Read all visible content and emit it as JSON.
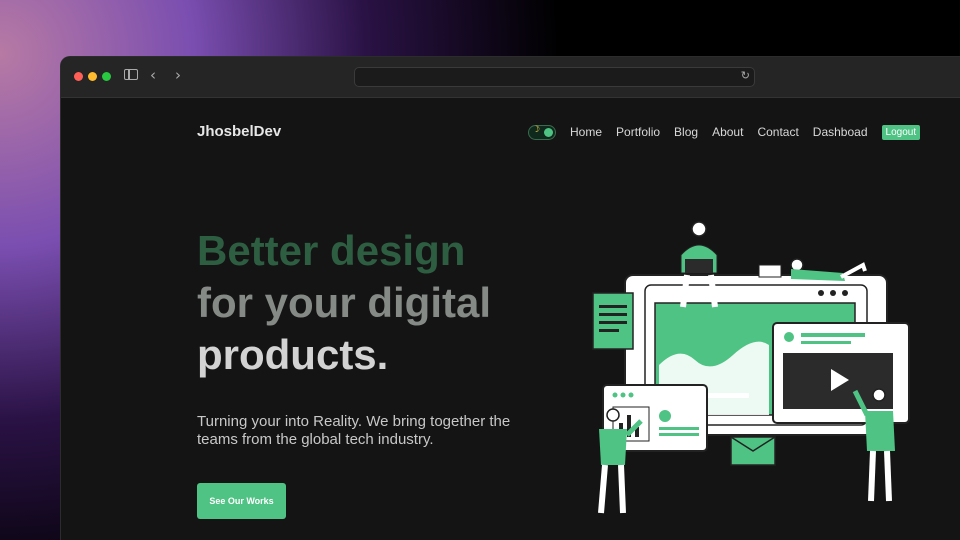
{
  "browser": {
    "address_value": ""
  },
  "site": {
    "logo": "JhosbelDev",
    "nav": {
      "items": [
        "Home",
        "Portfolio",
        "Blog",
        "About",
        "Contact",
        "Dashboad"
      ],
      "logout_label": "Logout",
      "theme_icon": "moon-icon"
    }
  },
  "hero": {
    "title_line1": "Better design",
    "title_line2": "for your digital",
    "title_line3": "products.",
    "subtitle": "Turning your into Reality. We bring together the teams from the global tech industry.",
    "cta_label": "See Our Works"
  },
  "colors": {
    "accent": "#4ec383",
    "background": "#141414"
  }
}
